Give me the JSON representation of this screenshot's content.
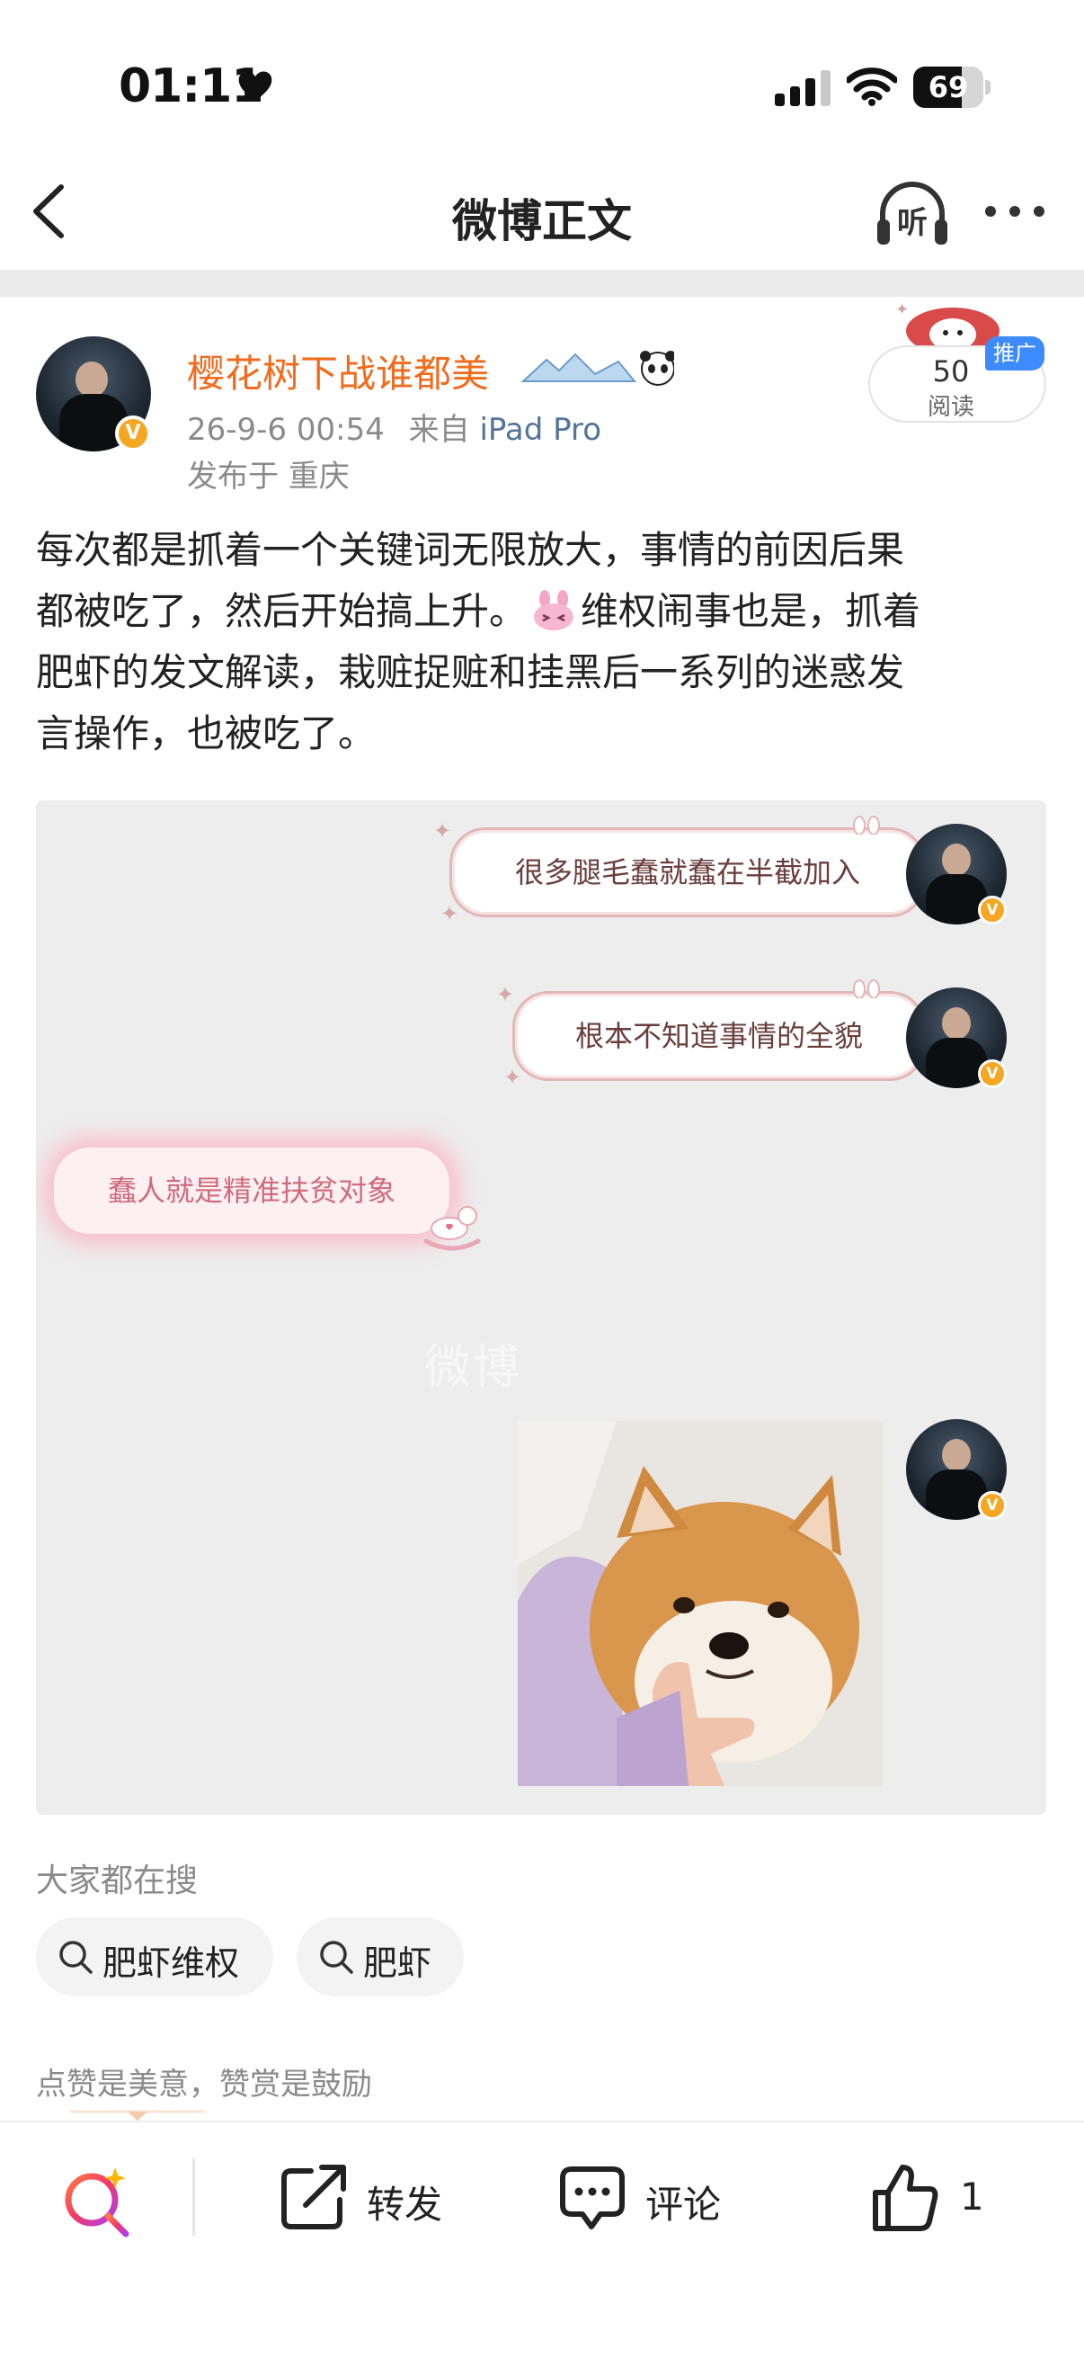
{
  "status_bar": {
    "time": "01:11",
    "battery_percent": "69",
    "battery_level": 0.69
  },
  "nav": {
    "title": "微博正文",
    "listen_label": "听"
  },
  "post": {
    "author": "樱花树下战谁都美",
    "verified_mark": "V",
    "date": "26-9-6 00:54",
    "source_prefix": "来自",
    "source": "iPad Pro",
    "location": "发布于 重庆",
    "read_count": "50",
    "read_label": "阅读",
    "promo_tag": "推广",
    "body_lines": [
      "每次都是抓着一个关键词无限放大，事情的前因后果",
      "都被吃了，然后开始搞上升。",
      "维权闹事也是，抓着",
      "肥虾的发文解读，栽赃捉赃和挂黑后一系列的迷惑发",
      "言操作，也被吃了。"
    ]
  },
  "chat_image": {
    "bubble_1": "很多腿毛蠢就蠢在半截加入",
    "bubble_2": "根本不知道事情的全貌",
    "bubble_left": "蠢人就是精准扶贫对象",
    "watermark": "微博"
  },
  "search": {
    "title": "大家都在搜",
    "chips": [
      "肥虾维权",
      "肥虾"
    ]
  },
  "reward_text": "点赞是美意，赞赏是鼓励",
  "toolbar": {
    "repost_label": "转发",
    "comment_label": "评论",
    "like_count": "1"
  },
  "colors": {
    "author_name": "#f26b1d",
    "source_link": "#53739a",
    "promo_tag": "#3d8bff",
    "verified_badge": "#f5a623",
    "bubble_border": "#e2b7b7",
    "glow_bubble": "#d06a7e"
  },
  "icons": [
    "heart-icon",
    "signal-icon",
    "wifi-icon",
    "battery-icon",
    "back-chevron-icon",
    "headphones-icon",
    "more-dots-icon",
    "bunny-emoji-icon",
    "search-icon",
    "sparkle-search-icon",
    "repost-icon",
    "comment-icon",
    "thumbs-up-icon"
  ]
}
